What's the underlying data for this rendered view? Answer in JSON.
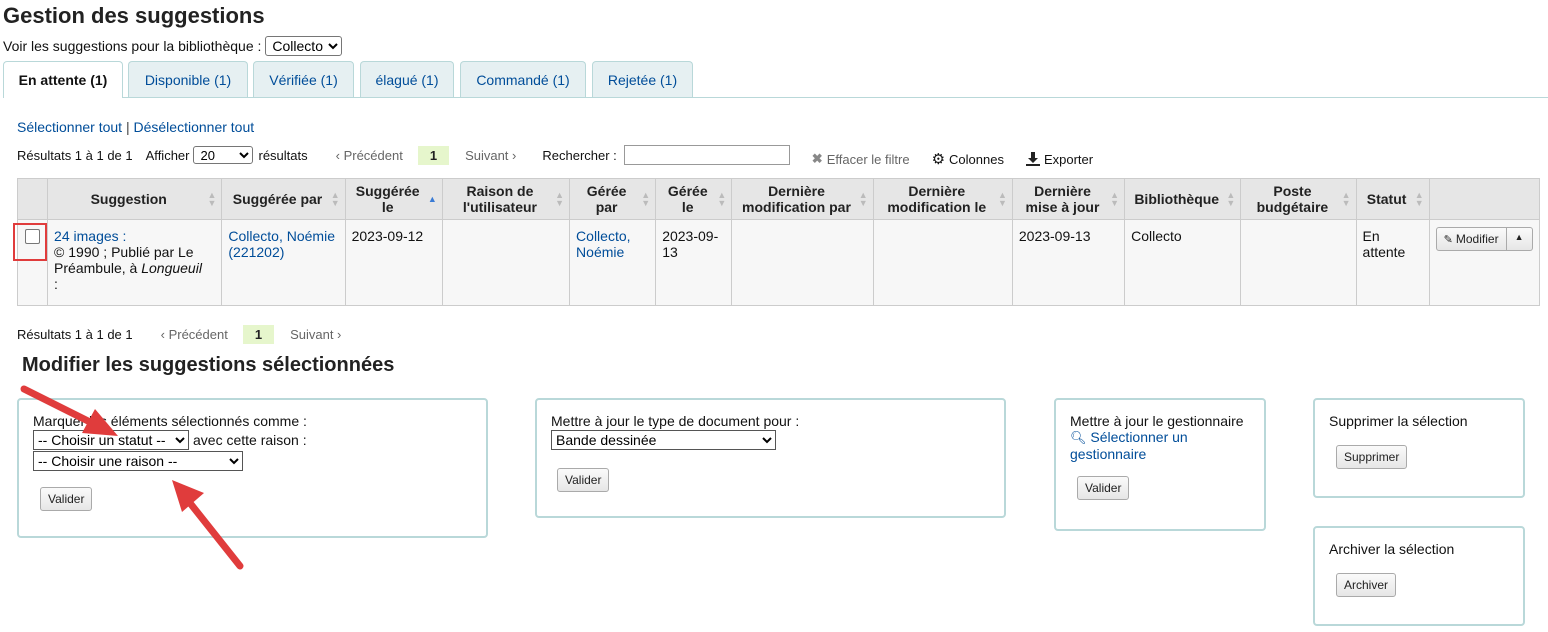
{
  "page": {
    "title": "Gestion des suggestions",
    "library_label": "Voir les suggestions pour la bibliothèque :",
    "library_value": "Collecto"
  },
  "tabs": [
    {
      "label": "En attente (1)"
    },
    {
      "label": "Disponible (1)"
    },
    {
      "label": "Vérifiée (1)"
    },
    {
      "label": "élagué (1)"
    },
    {
      "label": "Commandé (1)"
    },
    {
      "label": "Rejetée (1)"
    }
  ],
  "selection": {
    "select_all": "Sélectionner tout",
    "separator": "|",
    "deselect_all": "Désélectionner tout"
  },
  "toolbar": {
    "results": "Résultats 1 à 1 de 1",
    "show_label": "Afficher",
    "show_value": "20",
    "results_label": "résultats",
    "prev": "‹ Précédent",
    "page": "1",
    "next": "Suivant ›",
    "search_label": "Rechercher :",
    "clear_filter": "Effacer le filtre",
    "columns": "Colonnes",
    "export": "Exporter"
  },
  "table": {
    "headers": [
      "Suggestion",
      "Suggérée par",
      "Suggérée le",
      "Raison de l'utilisateur",
      "Gérée par",
      "Gérée le",
      "Dernière modification par",
      "Dernière modification le",
      "Dernière mise à jour",
      "Bibliothèque",
      "Poste budgétaire",
      "Statut"
    ],
    "row": {
      "title": "24 images :",
      "pub": "© 1990 ; Publié par Le Préambule, à",
      "place": "Longueuil",
      "trail": ":",
      "suggested_by": "Collecto, Noémie (221202)",
      "suggested_date": "2023-09-12",
      "reason": "",
      "managed_by": "Collecto, Noémie",
      "managed_date": "2023-09-13",
      "lastmod_by": "",
      "lastmod_date": "",
      "last_update": "2023-09-13",
      "library": "Collecto",
      "budget": "",
      "status": "En attente",
      "edit_label": "Modifier"
    }
  },
  "bottom_pager": {
    "results": "Résultats 1 à 1 de 1",
    "prev": "‹ Précédent",
    "page": "1",
    "next": "Suivant ›"
  },
  "modify": {
    "title": "Modifier les suggestions sélectionnées",
    "status_panel": {
      "label": "Marquer les éléments sélectionnés comme :",
      "status_select": "-- Choisir un statut --",
      "reason_label": "avec cette raison :",
      "reason_select": "-- Choisir une raison --",
      "submit": "Valider"
    },
    "doctype_panel": {
      "label": "Mettre à jour le type de document pour :",
      "select": "Bande dessinée",
      "submit": "Valider"
    },
    "manager_panel": {
      "label": "Mettre à jour le gestionnaire",
      "link": "Sélectionner un gestionnaire",
      "submit": "Valider"
    },
    "delete_panel": {
      "label": "Supprimer la sélection",
      "submit": "Supprimer"
    },
    "archive_panel": {
      "label": "Archiver la sélection",
      "submit": "Archiver"
    }
  },
  "colors": {
    "link": "#004d99",
    "annotation": "#e03c3c",
    "panel_border": "#b9d8d9"
  }
}
